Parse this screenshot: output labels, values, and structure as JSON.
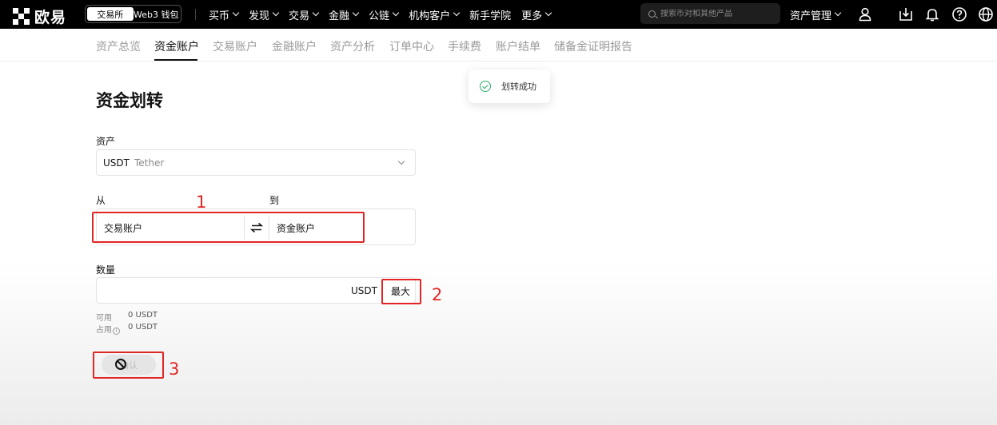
{
  "topbar": {
    "logo_text": "欧易",
    "switch": {
      "exchange": "交易所",
      "web3": "Web3 钱包"
    },
    "nav": [
      "买币",
      "发现",
      "交易",
      "金融",
      "公链",
      "机构客户",
      "新手学院",
      "更多"
    ],
    "nav_has_chevron": [
      true,
      true,
      true,
      true,
      true,
      true,
      false,
      true
    ],
    "search_placeholder": "搜索币对和其他产品",
    "asset_mgmt": "资产管理",
    "icons": [
      "user-icon",
      "download-icon",
      "bell-icon",
      "help-icon",
      "globe-icon"
    ]
  },
  "subnav": {
    "tabs": [
      "资产总览",
      "资金账户",
      "交易账户",
      "金融账户",
      "资产分析",
      "订单中心",
      "手续费",
      "账户结单",
      "储备金证明报告"
    ],
    "active_index": 1
  },
  "toast": {
    "text": "划转成功",
    "color": "#2aae6b"
  },
  "form": {
    "title": "资金划转",
    "asset_label": "资产",
    "asset_symbol": "USDT",
    "asset_name": "Tether",
    "from_label": "从",
    "to_label": "到",
    "from_account": "交易账户",
    "to_account": "资金账户",
    "amount_label": "数量",
    "amount_value": "",
    "amount_unit": "USDT",
    "max_label": "最大",
    "available_label": "可用",
    "available_value": "0 USDT",
    "occupied_label": "占用",
    "occupied_value": "0 USDT",
    "confirm_label": "确认",
    "confirm_disabled": true
  },
  "annotations": [
    {
      "number": "1",
      "color": "#e22626"
    },
    {
      "number": "2",
      "color": "#e22626"
    },
    {
      "number": "3",
      "color": "#e22626"
    }
  ]
}
